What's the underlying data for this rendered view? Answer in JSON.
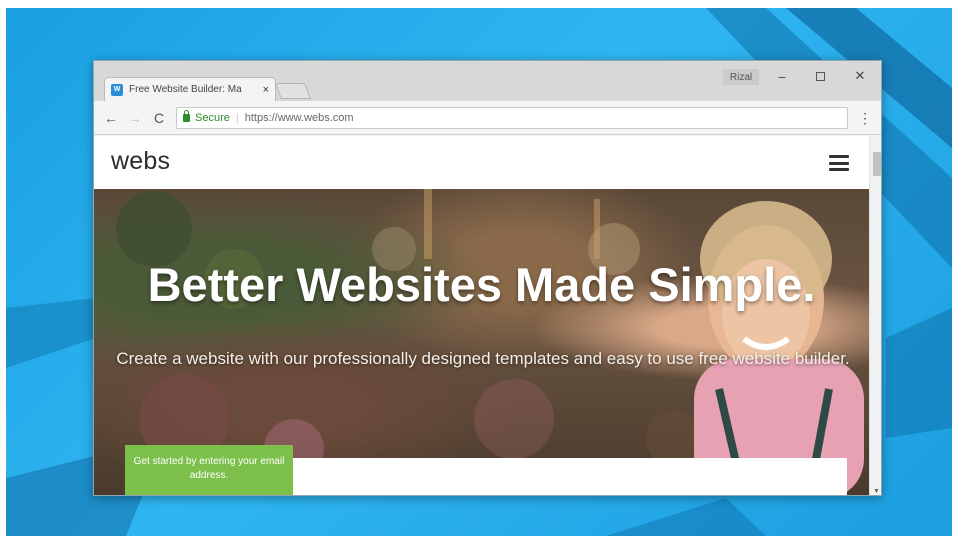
{
  "browser": {
    "tab_title": "Free Website Builder: Ma",
    "tab_close": "×",
    "favicon_text": "W",
    "profile_name": "Rizal",
    "window_buttons": {
      "minimize": "–",
      "close": "✕"
    },
    "nav": {
      "back": "←",
      "forward": "→",
      "reload": "C"
    },
    "address_bar": {
      "security_label": "Secure",
      "separator": "|",
      "url": "https://www.webs.com"
    },
    "menu_icon": "⋮"
  },
  "site": {
    "logo": "webs",
    "hero_title": "Better Websites Made Simple.",
    "hero_subtitle": "Create a website with our professionally designed templates and easy to use free website builder.",
    "cta_label": "Get started by entering your email address."
  },
  "colors": {
    "desktop_blue": "#1aa0e3",
    "cta_green": "#7cc04b",
    "secure_green": "#2e8b2e"
  },
  "icons": [
    "back-arrow-icon",
    "forward-arrow-icon",
    "reload-icon",
    "lock-icon",
    "kebab-menu-icon",
    "hamburger-menu-icon",
    "minimize-icon",
    "maximize-icon",
    "close-icon"
  ]
}
